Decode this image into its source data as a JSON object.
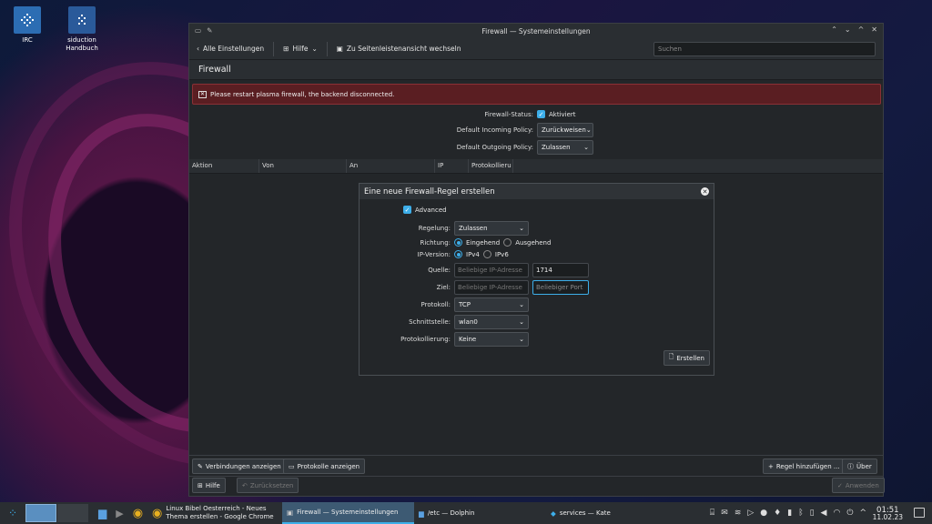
{
  "desktop": {
    "icons": [
      {
        "label": "IRC"
      },
      {
        "label_line1": "siduction",
        "label_line2": "Handbuch"
      }
    ]
  },
  "window": {
    "title": "Firewall — Systemeinstellungen",
    "toolbar": {
      "back_label": "Alle Einstellungen",
      "help_label": "Hilfe",
      "sidebar_label": "Zu Seitenleistenansicht wechseln",
      "search_placeholder": "Suchen"
    },
    "page_title": "Firewall",
    "error_message": "Please restart plasma firewall, the backend disconnected.",
    "status": {
      "label": "Firewall-Status:",
      "value": "Aktiviert",
      "incoming_label": "Default Incoming Policy:",
      "incoming_value": "Zurückweisen",
      "outgoing_label": "Default Outgoing Policy:",
      "outgoing_value": "Zulassen"
    },
    "table_headers": [
      "Aktion",
      "Von",
      "An",
      "IP",
      "Protokollieru"
    ],
    "footer": {
      "connections": "Verbindungen anzeigen",
      "logs": "Protokolle anzeigen",
      "add_rule": "Regel hinzufügen ...",
      "about": "Über",
      "help": "Hilfe",
      "reset": "Zurücksetzen",
      "apply": "Anwenden"
    }
  },
  "dialog": {
    "title": "Eine neue Firewall-Regel erstellen",
    "advanced": "Advanced",
    "policy_label": "Regelung:",
    "policy_value": "Zulassen",
    "direction_label": "Richtung:",
    "incoming": "Eingehend",
    "outgoing": "Ausgehend",
    "ipversion_label": "IP-Version:",
    "ipv4": "IPv4",
    "ipv6": "IPv6",
    "source_label": "Quelle:",
    "source_ip_placeholder": "Beliebige IP-Adresse",
    "source_port": "1714",
    "dest_label": "Ziel:",
    "dest_ip_placeholder": "Beliebige IP-Adresse",
    "dest_port_placeholder": "Beliebiger Port",
    "protocol_label": "Protokoll:",
    "protocol_value": "TCP",
    "interface_label": "Schnittstelle:",
    "interface_value": "wlan0",
    "logging_label": "Protokollierung:",
    "logging_value": "Keine",
    "create_button": "Erstellen"
  },
  "taskbar": {
    "tasks": [
      {
        "line1": "Linux Bibel Oesterreich - Neues",
        "line2": "Thema erstellen - Google Chrome"
      },
      {
        "label": "Firewall  — Systemeinstellungen"
      },
      {
        "label": "/etc — Dolphin"
      },
      {
        "label": "services  — Kate"
      }
    ],
    "time": "01:51",
    "date": "11.02.23"
  }
}
